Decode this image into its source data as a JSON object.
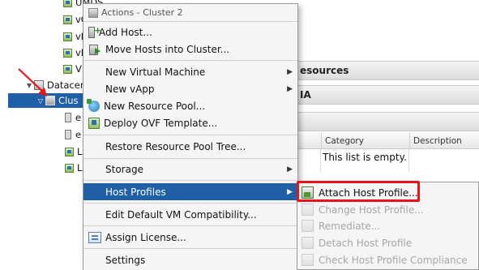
{
  "tree": {
    "items": [
      {
        "label": "UMDS"
      },
      {
        "label": "vC"
      },
      {
        "label": "vR"
      },
      {
        "label": "vR"
      },
      {
        "label": "V"
      },
      {
        "label": "Datacer"
      },
      {
        "label": "Clus"
      },
      {
        "label": "e"
      },
      {
        "label": "e"
      },
      {
        "label": "L"
      },
      {
        "label": "L"
      }
    ]
  },
  "panel": {
    "tab_resources": "esources",
    "tab_ha": "IA",
    "columns": [
      "Category",
      "Description"
    ],
    "empty_message": "This list is empty."
  },
  "menu": {
    "title": "Actions - Cluster 2",
    "items": [
      {
        "label": "Add Host...",
        "icon": "add-host-icon"
      },
      {
        "label": "Move Hosts into Cluster...",
        "icon": "move-hosts-icon"
      },
      {
        "label": "New Virtual Machine",
        "submenu": true
      },
      {
        "label": "New vApp",
        "submenu": true
      },
      {
        "label": "New Resource Pool...",
        "icon": "resource-pool-icon"
      },
      {
        "label": "Deploy OVF Template...",
        "icon": "ovf-icon"
      },
      {
        "label": "Restore Resource Pool Tree..."
      },
      {
        "label": "Storage",
        "submenu": true
      },
      {
        "label": "Host Profiles",
        "submenu": true,
        "active": true
      },
      {
        "label": "Edit Default VM Compatibility..."
      },
      {
        "label": "Assign License...",
        "icon": "license-icon"
      },
      {
        "label": "Settings"
      }
    ]
  },
  "submenu": {
    "items": [
      {
        "label": "Attach Host Profile...",
        "enabled": true
      },
      {
        "label": "Change Host Profile...",
        "enabled": false
      },
      {
        "label": "Remediate...",
        "enabled": false
      },
      {
        "label": "Detach Host Profile",
        "enabled": false
      },
      {
        "label": "Check Host Profile Compliance",
        "enabled": false
      }
    ]
  },
  "colors": {
    "selection": "#1f5fa6",
    "highlight_box": "#e8141b",
    "annotation_arrow": "#e8141b"
  }
}
